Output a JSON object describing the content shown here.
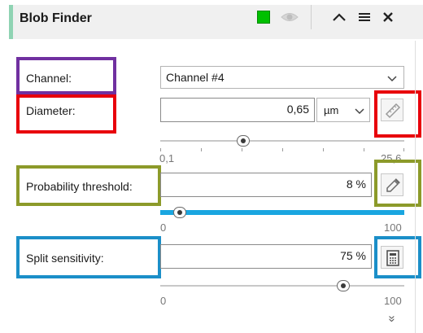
{
  "header": {
    "title": "Blob Finder",
    "color_swatch": "#00C000",
    "icons": [
      "visibility-eye-icon",
      "collapse-up-icon",
      "menu-icon",
      "close-icon"
    ],
    "close_glyph": "✕",
    "menu_glyph": "≡"
  },
  "channel": {
    "label": "Channel:",
    "value": "Channel #4",
    "highlight_color": "#7030A0"
  },
  "diameter": {
    "label": "Diameter:",
    "value": "0,65",
    "unit": "µm",
    "range_min": "0,1",
    "range_max": "25,6",
    "slider_fraction": 0.34,
    "tool_icon": "ruler-measure-icon",
    "highlight_color": "#E8000B"
  },
  "probability_threshold": {
    "label": "Probability threshold:",
    "value": "8 %",
    "range_min": "0",
    "range_max": "100",
    "slider_fraction": 0.08,
    "tool_icon": "eyedropper-icon",
    "highlight_color": "#8C9A2A"
  },
  "split_sensitivity": {
    "label": "Split sensitivity:",
    "value": "75 %",
    "range_min": "0",
    "range_max": "100",
    "slider_fraction": 0.75,
    "tool_icon": "calculator-icon",
    "highlight_color": "#1B8FC8"
  },
  "footer": {
    "more_glyph": "»",
    "more_icon": "expand-more-chevrons-icon"
  }
}
